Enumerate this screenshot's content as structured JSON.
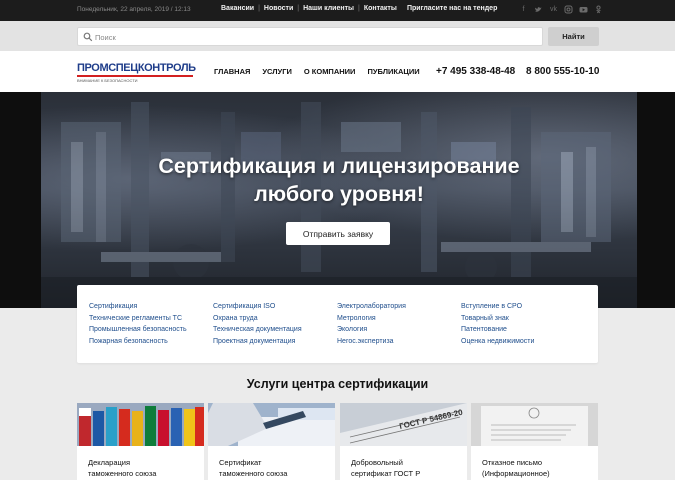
{
  "topbar": {
    "date": "Понедельник, 22 апреля, 2019 / 12:13",
    "nav": [
      "Вакансии",
      "Новости",
      "Наши клиенты",
      "Контакты"
    ],
    "tender": "Пригласите нас на тендер",
    "socials": [
      "facebook-icon",
      "twitter-icon",
      "vk-icon",
      "instagram-icon",
      "youtube-icon",
      "ok-icon"
    ]
  },
  "search": {
    "placeholder": "Поиск",
    "value": "",
    "button": "Найти"
  },
  "header": {
    "logo_name": "ПРОМСПЕЦКОНТРОЛЬ",
    "logo_tag": "ВНИМАНИЕ К БЕЗОПАСНОСТИ",
    "nav": [
      "ГЛАВНАЯ",
      "УСЛУГИ",
      "О КОМПАНИИ",
      "ПУБЛИКАЦИИ"
    ],
    "phone1": "+7 495 338-48-48",
    "phone2": "8 800 555-10-10"
  },
  "hero": {
    "title_line1": "Сертификация и лицензирование",
    "title_line2": "любого уровня!",
    "button": "Отправить заявку"
  },
  "links": {
    "col1": [
      "Сертификация",
      "Технические регламенты ТС",
      "Промышленная безопасность",
      "Пожарная безопасность"
    ],
    "col2": [
      "Сертификация ISO",
      "Охрана труда",
      "Техническая документация",
      "Проектная документация"
    ],
    "col3": [
      "Электролаборатория",
      "Метрология",
      "Экология",
      "Негос.экспертиза"
    ],
    "col4": [
      "Вступление в СРО",
      "Товарный знак",
      "Патентование",
      "Оценка недвижимости"
    ]
  },
  "section_title": "Услуги центра сертификации",
  "cards": [
    {
      "line1": "Декларация",
      "line2": "таможенного союза"
    },
    {
      "line1": "Сертификат",
      "line2": "таможенного союза"
    },
    {
      "line1": "Добровольный",
      "line2": "сертификат ГОСТ Р"
    },
    {
      "line1": "Отказное письмо",
      "line2": "(Информационное)"
    }
  ],
  "card3_doc_text": "ГОСТ Р 54869-20",
  "colors": {
    "topbar": "#1c1c1c",
    "logo_blue": "#1f3d8a",
    "logo_red": "#d32020",
    "link_blue": "#1f4e8c",
    "page_bg": "#ebebeb"
  }
}
